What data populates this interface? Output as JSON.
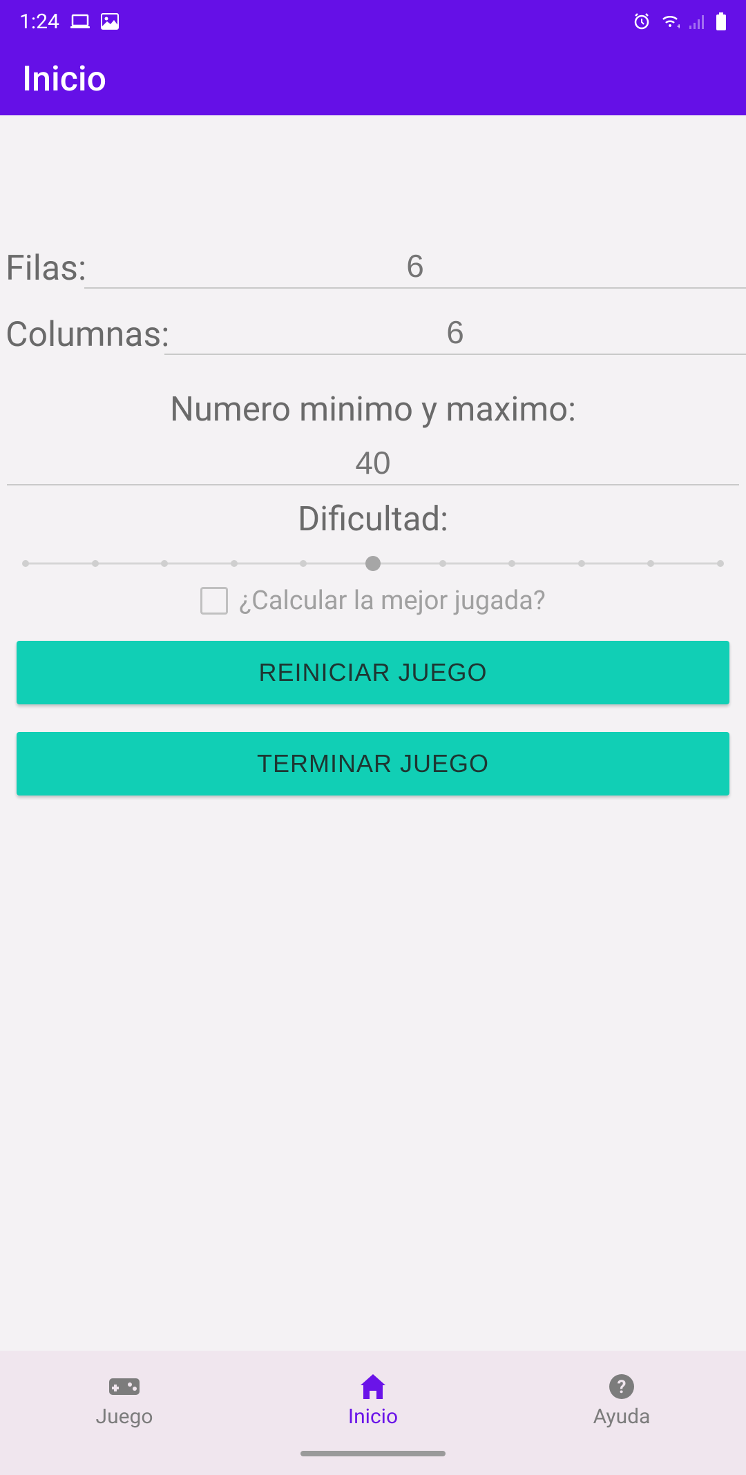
{
  "statusBar": {
    "time": "1:24"
  },
  "appBar": {
    "title": "Inicio"
  },
  "form": {
    "rowsLabel": "Filas:",
    "rowsPlaceholder": "6",
    "colsLabel": "Columnas:",
    "colsPlaceholder": "6",
    "rangeLabel": "Numero minimo y maximo:",
    "rangePlaceholder": "40",
    "difficultyLabel": "Dificultad:",
    "difficultyValue": 5,
    "difficultySteps": 11,
    "checkboxLabel": "¿Calcular la mejor jugada?",
    "checkboxChecked": false,
    "restartButton": "REINICIAR JUEGO",
    "endButton": "TERMINAR JUEGO"
  },
  "bottomNav": {
    "items": [
      {
        "label": "Juego",
        "icon": "gamepad-icon",
        "active": false
      },
      {
        "label": "Inicio",
        "icon": "home-icon",
        "active": true
      },
      {
        "label": "Ayuda",
        "icon": "help-icon",
        "active": false
      }
    ]
  },
  "colors": {
    "primary": "#6510e7",
    "accent": "#11cfb5",
    "activeNav": "#6a14e8"
  }
}
